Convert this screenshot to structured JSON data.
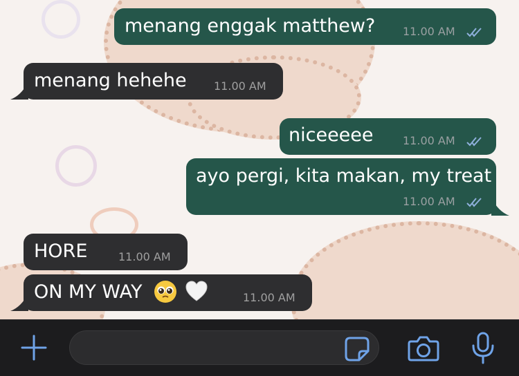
{
  "messages": [
    {
      "id": "m1",
      "direction": "out",
      "text": "menang enggak matthew?",
      "time": "11.00 AM",
      "read": true
    },
    {
      "id": "m2",
      "direction": "in",
      "text": "menang hehehe",
      "time": "11.00 AM"
    },
    {
      "id": "m3",
      "direction": "out",
      "text": "niceeeee",
      "time": "11.00 AM",
      "read": true
    },
    {
      "id": "m4",
      "direction": "out",
      "text": "ayo pergi, kita makan, my treat",
      "time": "11.00 AM",
      "read": true
    },
    {
      "id": "m5",
      "direction": "in",
      "text": "HORE",
      "time": "11.00 AM"
    },
    {
      "id": "m6",
      "direction": "in",
      "text": "ON MY WAY",
      "time": "11.00 AM",
      "emojis": [
        "pleading-face-emoji",
        "white-heart-emoji"
      ]
    }
  ],
  "composer": {
    "input_value": "",
    "icons": [
      "plus-icon",
      "sticker-icon",
      "camera-icon",
      "microphone-icon"
    ]
  },
  "colors": {
    "outgoing_bubble": "#25564a",
    "incoming_bubble": "#2e2e30",
    "accent": "#6fa3e8",
    "bar": "#1c1c1e"
  }
}
